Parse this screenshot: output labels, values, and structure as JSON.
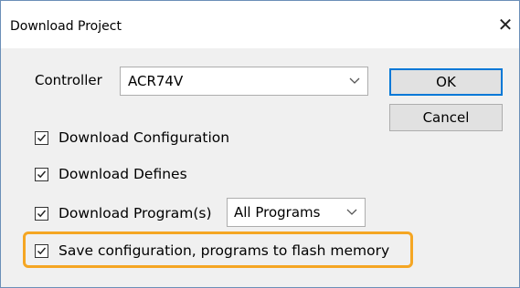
{
  "window": {
    "title": "Download Project",
    "close_icon": "close-icon"
  },
  "controller": {
    "label": "Controller",
    "selected": "ACR74V"
  },
  "buttons": {
    "ok": "OK",
    "cancel": "Cancel"
  },
  "options": [
    {
      "label": "Download Configuration",
      "checked": true
    },
    {
      "label": "Download Defines",
      "checked": true
    },
    {
      "label": "Download Program(s)",
      "checked": true
    },
    {
      "label": "Save configuration, programs to flash memory",
      "checked": true
    }
  ],
  "programs_select": {
    "selected": "All Programs"
  },
  "colors": {
    "highlight": "#f5a623",
    "default_button_border": "#0078d7",
    "dialog_bg": "#f0f0f0"
  }
}
